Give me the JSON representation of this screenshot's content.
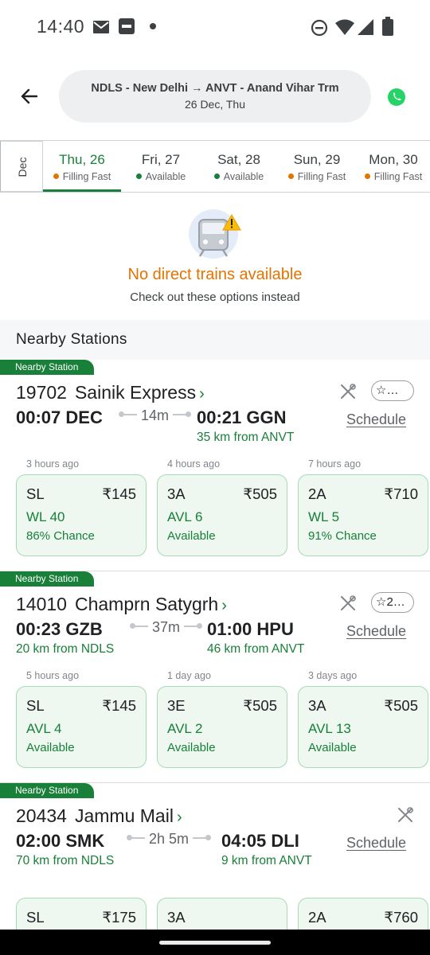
{
  "status_bar": {
    "time": "14:40"
  },
  "header": {
    "route": "NDLS - New Delhi → ANVT - Anand Vihar Trm",
    "date": "26 Dec, Thu"
  },
  "date_strip": {
    "month": "Dec",
    "tabs": [
      {
        "day": "Thu, 26",
        "status": "Filling Fast",
        "status_color": "#e37400",
        "active": true
      },
      {
        "day": "Fri, 27",
        "status": "Available",
        "status_color": "#188038",
        "active": false
      },
      {
        "day": "Sat, 28",
        "status": "Available",
        "status_color": "#188038",
        "active": false
      },
      {
        "day": "Sun, 29",
        "status": "Filling Fast",
        "status_color": "#e37400",
        "active": false
      },
      {
        "day": "Mon, 30",
        "status": "Filling Fast",
        "status_color": "#e37400",
        "active": false
      }
    ]
  },
  "no_trains": {
    "title": "No direct trains available",
    "subtitle": "Check out these options instead"
  },
  "nearby": {
    "heading": "Nearby Stations",
    "trains": [
      {
        "badge": "Nearby Station",
        "number": "19702",
        "name": "Sainik Express",
        "rating": "…",
        "dep": "00:07 DEC",
        "duration": "14m",
        "arr": "00:21 GGN",
        "dep_note": "",
        "arr_note": "35 km from ANVT",
        "schedule_label": "Schedule",
        "classes": [
          {
            "updated": "3 hours ago",
            "code": "SL",
            "price": "₹145",
            "status": "WL 40",
            "note": "86% Chance"
          },
          {
            "updated": "4 hours ago",
            "code": "3A",
            "price": "₹505",
            "status": "AVL 6",
            "note": "Available"
          },
          {
            "updated": "7 hours ago",
            "code": "2A",
            "price": "₹710",
            "status": "WL 5",
            "note": "91% Chance"
          }
        ]
      },
      {
        "badge": "Nearby Station",
        "number": "14010",
        "name": "Champrn Satygrh",
        "rating": "2…",
        "dep": "00:23 GZB",
        "duration": "37m",
        "arr": "01:00 HPU",
        "dep_note": "20 km from NDLS",
        "arr_note": "46 km from ANVT",
        "schedule_label": "Schedule",
        "classes": [
          {
            "updated": "5 hours ago",
            "code": "SL",
            "price": "₹145",
            "status": "AVL 4",
            "note": "Available"
          },
          {
            "updated": "1 day ago",
            "code": "3E",
            "price": "₹505",
            "status": "AVL 2",
            "note": "Available"
          },
          {
            "updated": "3 days ago",
            "code": "3A",
            "price": "₹505",
            "status": "AVL 13",
            "note": "Available"
          }
        ]
      },
      {
        "badge": "Nearby Station",
        "number": "20434",
        "name": "Jammu Mail",
        "rating": "",
        "dep": "02:00 SMK",
        "duration": "2h 5m",
        "arr": "04:05 DLI",
        "dep_note": "70 km from NDLS",
        "arr_note": "9 km from ANVT",
        "schedule_label": "Schedule",
        "classes": [
          {
            "updated": "",
            "code": "SL",
            "price": "₹175",
            "status": "",
            "note": ""
          },
          {
            "updated": "",
            "code": "3A",
            "price": "",
            "status": "",
            "note": ""
          },
          {
            "updated": "",
            "code": "2A",
            "price": "₹760",
            "status": "",
            "note": ""
          }
        ]
      }
    ]
  }
}
